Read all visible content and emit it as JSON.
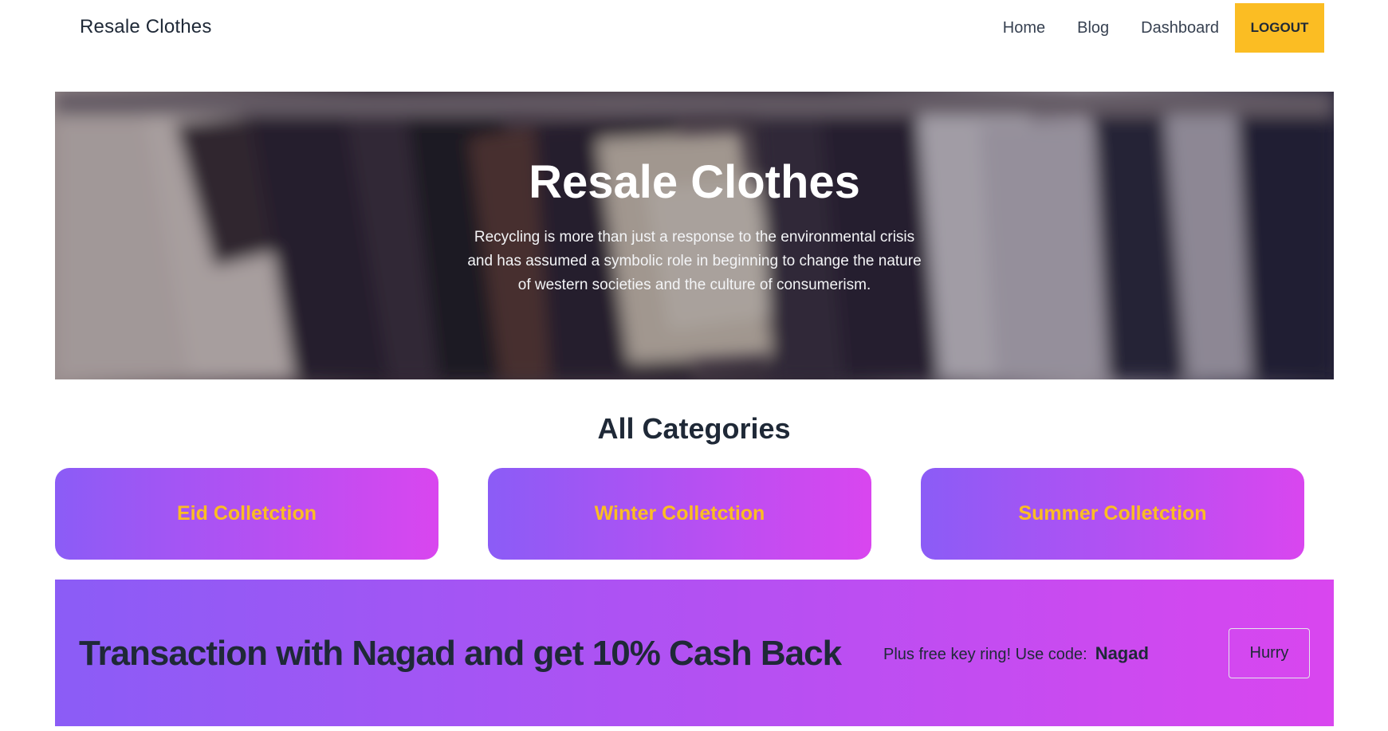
{
  "navbar": {
    "brand": "Resale Clothes",
    "links": [
      "Home",
      "Blog",
      "Dashboard"
    ],
    "logout_label": "LOGOUT"
  },
  "hero": {
    "title": "Resale Clothes",
    "text": "Recycling is more than just a response to the environmental crisis and has assumed a symbolic role in beginning to change the nature of western societies and the culture of consumerism."
  },
  "categories": {
    "title": "All Categories",
    "items": [
      "Eid Colletction",
      "Winter Colletction",
      "Summer Colletction"
    ]
  },
  "promo": {
    "title": "Transaction with Nagad and get 10% Cash Back",
    "text": "Plus free key ring! Use code:",
    "code": "Nagad",
    "button_label": "Hurry"
  },
  "colors": {
    "accent_yellow": "#fbbd23",
    "gradient_start": "#8b5cf6",
    "gradient_end": "#d946ef",
    "text_dark": "#1f2937"
  }
}
